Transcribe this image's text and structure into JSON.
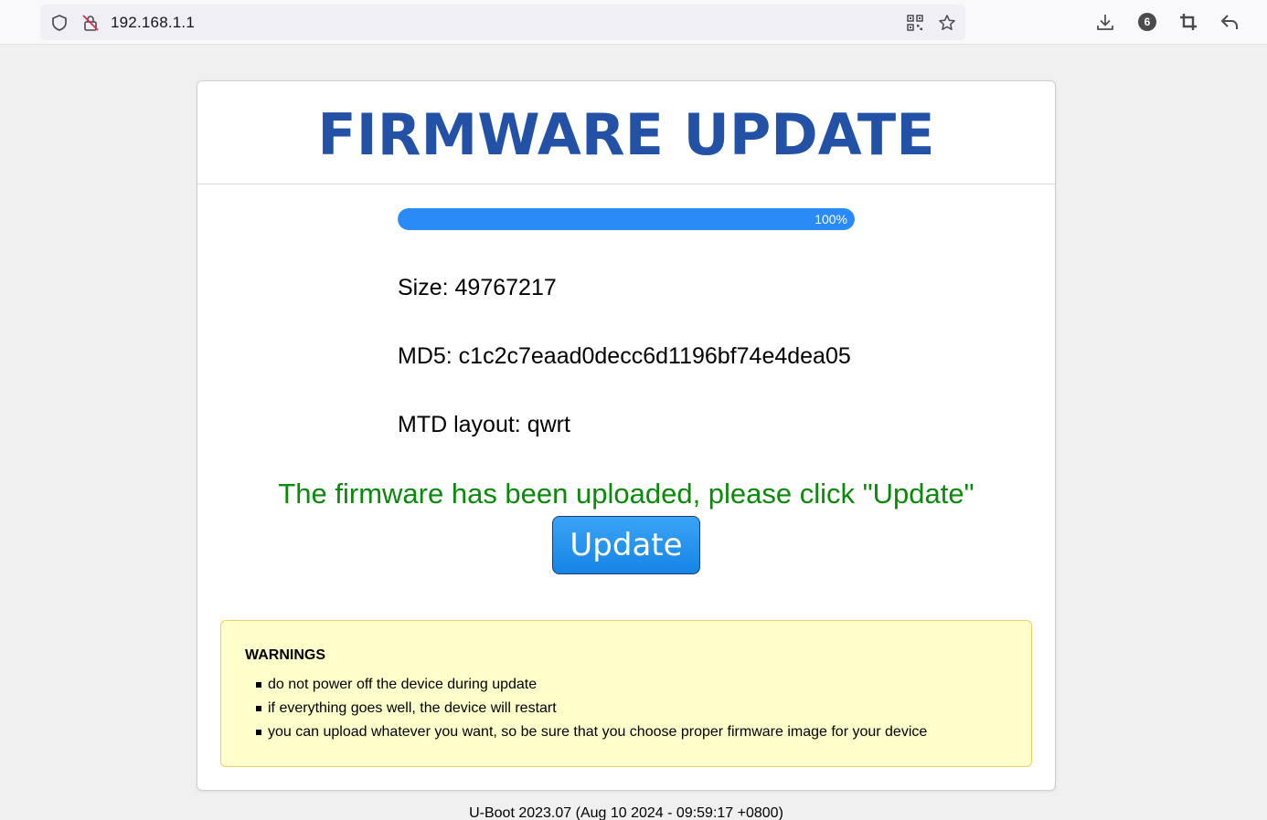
{
  "browser": {
    "url": "192.168.1.1",
    "extensions_badge": "6",
    "icons": [
      "shield-icon",
      "insecure-lock-icon",
      "qr-code-icon",
      "bookmark-star-icon",
      "download-icon",
      "extensions-badge-icon",
      "crop-icon",
      "back-arrow-icon"
    ]
  },
  "page": {
    "title": "FIRMWARE UPDATE",
    "progress": {
      "value": 1.0,
      "label": "100%"
    },
    "size_line": "Size: 49767217",
    "md5_line": "MD5: c1c2c7eaad0decc6d1196bf74e4dea05",
    "mtd_line": "MTD layout: qwrt",
    "status_message": "The firmware has been uploaded, please click \"Update\"",
    "update_button": "Update",
    "warnings": {
      "title": "WARNINGS",
      "items": [
        "do not power off the device during update",
        "if everything goes well, the device will restart",
        "you can upload whatever you want, so be sure that you choose proper firmware image for your device"
      ]
    },
    "footer": "U-Boot 2023.07 (Aug 10 2024 - 09:59:17 +0800)"
  },
  "colors": {
    "title": "#2251a6",
    "progress": "#2a8af6",
    "status": "#0a8a0a",
    "button": "#1584e6",
    "warning_bg": "#ffffcc"
  }
}
